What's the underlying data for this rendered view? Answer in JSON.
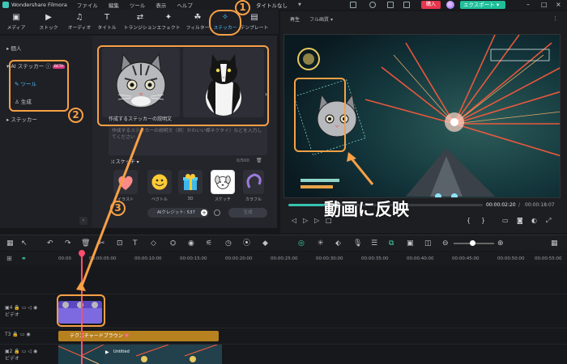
{
  "menubar": {
    "app_name": "Wondershare Filmora",
    "items": [
      "ファイル",
      "編集",
      "ツール",
      "表示",
      "ヘルプ"
    ],
    "project_title": "タイトルなし",
    "buy_label": "購入",
    "export_label": "エクスポート"
  },
  "toolbar": {
    "tabs": [
      {
        "label": "メディア",
        "icon": "media-icon"
      },
      {
        "label": "ストック",
        "icon": "stock-icon"
      },
      {
        "label": "オーディオ",
        "icon": "audio-icon"
      },
      {
        "label": "タイトル",
        "icon": "title-icon"
      },
      {
        "label": "トランジション",
        "icon": "transition-icon"
      },
      {
        "label": "エフェクト",
        "icon": "effect-icon"
      },
      {
        "label": "フィルター",
        "icon": "filter-icon"
      },
      {
        "label": "ステッカー",
        "icon": "sticker-icon"
      },
      {
        "label": "テンプレート",
        "icon": "template-icon"
      }
    ],
    "active_index": 7
  },
  "left_panel": {
    "personal": "個人",
    "ai_sticker": "AI ステッカー",
    "ai_badge": "BETA",
    "tools": "ツール",
    "generate": "生成",
    "sticker": "ステッカー"
  },
  "sticker_panel": {
    "desc_title": "作成するステッカーの説明文",
    "desc_placeholder": "作成するステッカーの説明文（例：かわいい蝶ネクタイ）などを入力してください",
    "desc_count": "0/500",
    "style_label": "スケッチ",
    "styles": [
      "イラスト",
      "ベクトル",
      "3D",
      "スケッチ",
      "カラフル"
    ],
    "credit_label": "AIクレジット: 537",
    "generate_label": "生成"
  },
  "preview": {
    "label": "再生",
    "quality": "フル画質",
    "time_current": "00:00:02:20",
    "time_total": "00:00:18:07"
  },
  "annotations": {
    "caption": "動画に反映",
    "step1": "1",
    "step2": "2",
    "step3": "3"
  },
  "ruler": {
    "ticks": [
      "00:00",
      "00:00:05:00",
      "00:00:10:00",
      "00:00:15:00",
      "00:00:20:00",
      "00:00:25:00",
      "00:00:30:00",
      "00:00:35:00",
      "00:00:40:00",
      "00:00:45:00",
      "00:00:50:00",
      "00:00:55:00"
    ]
  },
  "tracks": {
    "track4": "4",
    "track3": "3",
    "track2": "2",
    "video_label": "ビデオ",
    "text_clip": "テクスチャードブラウン",
    "video_clip_a": "Untitled",
    "video_clip_b": "Untitled"
  }
}
